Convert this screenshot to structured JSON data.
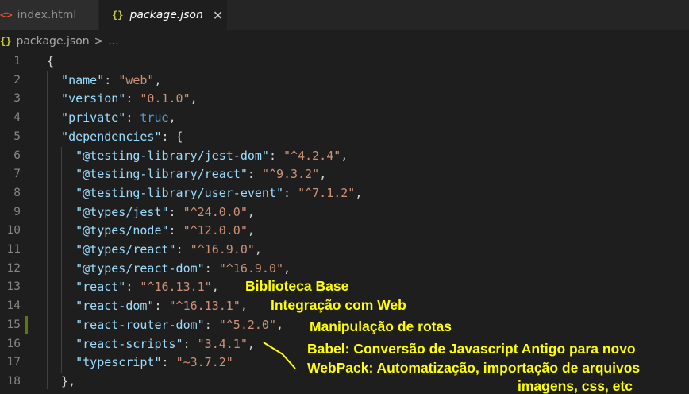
{
  "tabs": [
    {
      "label": "index.html",
      "icon": "html-file-icon",
      "active": false
    },
    {
      "label": "package.json",
      "icon": "json-file-icon",
      "active": true
    }
  ],
  "breadcrumb": {
    "file": "package.json",
    "separator": ">",
    "more": "..."
  },
  "lines": [
    {
      "num": "1",
      "tokens": [
        {
          "t": "punc",
          "v": "{"
        }
      ]
    },
    {
      "num": "2",
      "tokens": [
        {
          "t": "key",
          "v": "  \"name\""
        },
        {
          "t": "punc",
          "v": ": "
        },
        {
          "t": "str",
          "v": "\"web\""
        },
        {
          "t": "punc",
          "v": ","
        }
      ]
    },
    {
      "num": "3",
      "tokens": [
        {
          "t": "key",
          "v": "  \"version\""
        },
        {
          "t": "punc",
          "v": ": "
        },
        {
          "t": "str",
          "v": "\"0.1.0\""
        },
        {
          "t": "punc",
          "v": ","
        }
      ]
    },
    {
      "num": "4",
      "tokens": [
        {
          "t": "key",
          "v": "  \"private\""
        },
        {
          "t": "punc",
          "v": ": "
        },
        {
          "t": "bool",
          "v": "true"
        },
        {
          "t": "punc",
          "v": ","
        }
      ]
    },
    {
      "num": "5",
      "tokens": [
        {
          "t": "key",
          "v": "  \"dependencies\""
        },
        {
          "t": "punc",
          "v": ": {"
        }
      ]
    },
    {
      "num": "6",
      "tokens": [
        {
          "t": "key",
          "v": "    \"@testing-library/jest-dom\""
        },
        {
          "t": "punc",
          "v": ": "
        },
        {
          "t": "str",
          "v": "\"^4.2.4\""
        },
        {
          "t": "punc",
          "v": ","
        }
      ]
    },
    {
      "num": "7",
      "tokens": [
        {
          "t": "key",
          "v": "    \"@testing-library/react\""
        },
        {
          "t": "punc",
          "v": ": "
        },
        {
          "t": "str",
          "v": "\"^9.3.2\""
        },
        {
          "t": "punc",
          "v": ","
        }
      ]
    },
    {
      "num": "8",
      "tokens": [
        {
          "t": "key",
          "v": "    \"@testing-library/user-event\""
        },
        {
          "t": "punc",
          "v": ": "
        },
        {
          "t": "str",
          "v": "\"^7.1.2\""
        },
        {
          "t": "punc",
          "v": ","
        }
      ]
    },
    {
      "num": "9",
      "tokens": [
        {
          "t": "key",
          "v": "    \"@types/jest\""
        },
        {
          "t": "punc",
          "v": ": "
        },
        {
          "t": "str",
          "v": "\"^24.0.0\""
        },
        {
          "t": "punc",
          "v": ","
        }
      ]
    },
    {
      "num": "10",
      "tokens": [
        {
          "t": "key",
          "v": "    \"@types/node\""
        },
        {
          "t": "punc",
          "v": ": "
        },
        {
          "t": "str",
          "v": "\"^12.0.0\""
        },
        {
          "t": "punc",
          "v": ","
        }
      ]
    },
    {
      "num": "11",
      "tokens": [
        {
          "t": "key",
          "v": "    \"@types/react\""
        },
        {
          "t": "punc",
          "v": ": "
        },
        {
          "t": "str",
          "v": "\"^16.9.0\""
        },
        {
          "t": "punc",
          "v": ","
        }
      ]
    },
    {
      "num": "12",
      "tokens": [
        {
          "t": "key",
          "v": "    \"@types/react-dom\""
        },
        {
          "t": "punc",
          "v": ": "
        },
        {
          "t": "str",
          "v": "\"^16.9.0\""
        },
        {
          "t": "punc",
          "v": ","
        }
      ]
    },
    {
      "num": "13",
      "tokens": [
        {
          "t": "key",
          "v": "    \"react\""
        },
        {
          "t": "punc",
          "v": ": "
        },
        {
          "t": "str",
          "v": "\"^16.13.1\""
        },
        {
          "t": "punc",
          "v": ","
        }
      ]
    },
    {
      "num": "14",
      "tokens": [
        {
          "t": "key",
          "v": "    \"react-dom\""
        },
        {
          "t": "punc",
          "v": ": "
        },
        {
          "t": "str",
          "v": "\"^16.13.1\""
        },
        {
          "t": "punc",
          "v": ","
        }
      ]
    },
    {
      "num": "15",
      "tokens": [
        {
          "t": "key",
          "v": "    \"react-router-dom\""
        },
        {
          "t": "punc",
          "v": ": "
        },
        {
          "t": "str",
          "v": "\"^5.2.0\""
        },
        {
          "t": "punc",
          "v": ","
        }
      ]
    },
    {
      "num": "16",
      "tokens": [
        {
          "t": "key",
          "v": "    \"react-scripts\""
        },
        {
          "t": "punc",
          "v": ": "
        },
        {
          "t": "str",
          "v": "\"3.4.1\""
        },
        {
          "t": "punc",
          "v": ","
        }
      ]
    },
    {
      "num": "17",
      "tokens": [
        {
          "t": "key",
          "v": "    \"typescript\""
        },
        {
          "t": "punc",
          "v": ": "
        },
        {
          "t": "str",
          "v": "\"~3.7.2\""
        }
      ]
    },
    {
      "num": "18",
      "tokens": [
        {
          "t": "punc",
          "v": "  },"
        }
      ]
    }
  ],
  "annotations": {
    "react": "Biblioteca Base",
    "react_dom": "Integração com Web",
    "router": "Manipulação de rotas",
    "babel": "Babel: Conversão de Javascript Antigo para novo",
    "webpack": "WebPack: Automatização, importação de arquivos",
    "webpack_cont": "imagens, css, etc"
  },
  "colors": {
    "annotation": "#ffff00",
    "key": "#9cdcfe",
    "string": "#ce9178",
    "boolean": "#569cd6",
    "modified_gutter": "#587c0c"
  }
}
